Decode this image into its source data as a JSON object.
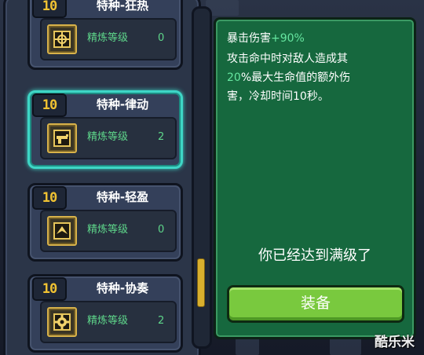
{
  "equipment_list": {
    "items": [
      {
        "level_badge": "10",
        "name": "特种-狂热",
        "refine_label": "精炼等级",
        "refine_value": "0",
        "selected": false,
        "icon": "crosshair-chip-icon"
      },
      {
        "level_badge": "10",
        "name": "特种-律动",
        "refine_label": "精炼等级",
        "refine_value": "2",
        "selected": true,
        "icon": "gun-chip-icon"
      },
      {
        "level_badge": "10",
        "name": "特种-轻盈",
        "refine_label": "精炼等级",
        "refine_value": "0",
        "selected": false,
        "icon": "wing-chip-icon"
      },
      {
        "level_badge": "10",
        "name": "特种-协奏",
        "refine_label": "精炼等级",
        "refine_value": "2",
        "selected": false,
        "icon": "gear-chip-icon"
      }
    ]
  },
  "detail": {
    "title_prefix": "暴击伤害",
    "title_bonus": "+90%",
    "desc_line1": "攻击命中时对敌人造成其",
    "desc_line2_value": "20",
    "desc_line2_rest": "%最大生命值的额外伤",
    "desc_line3": "害，冷却时间10秒。",
    "max_level_text": "你已经达到满级了",
    "equip_label": "装备"
  },
  "watermark": "酷乐米",
  "colors": {
    "panel_green": "#16683e",
    "accent_green": "#66e6a0",
    "level_gold": "#f0c232",
    "selected_cyan": "#3ed6c6",
    "equip_button": "#79c93e"
  }
}
